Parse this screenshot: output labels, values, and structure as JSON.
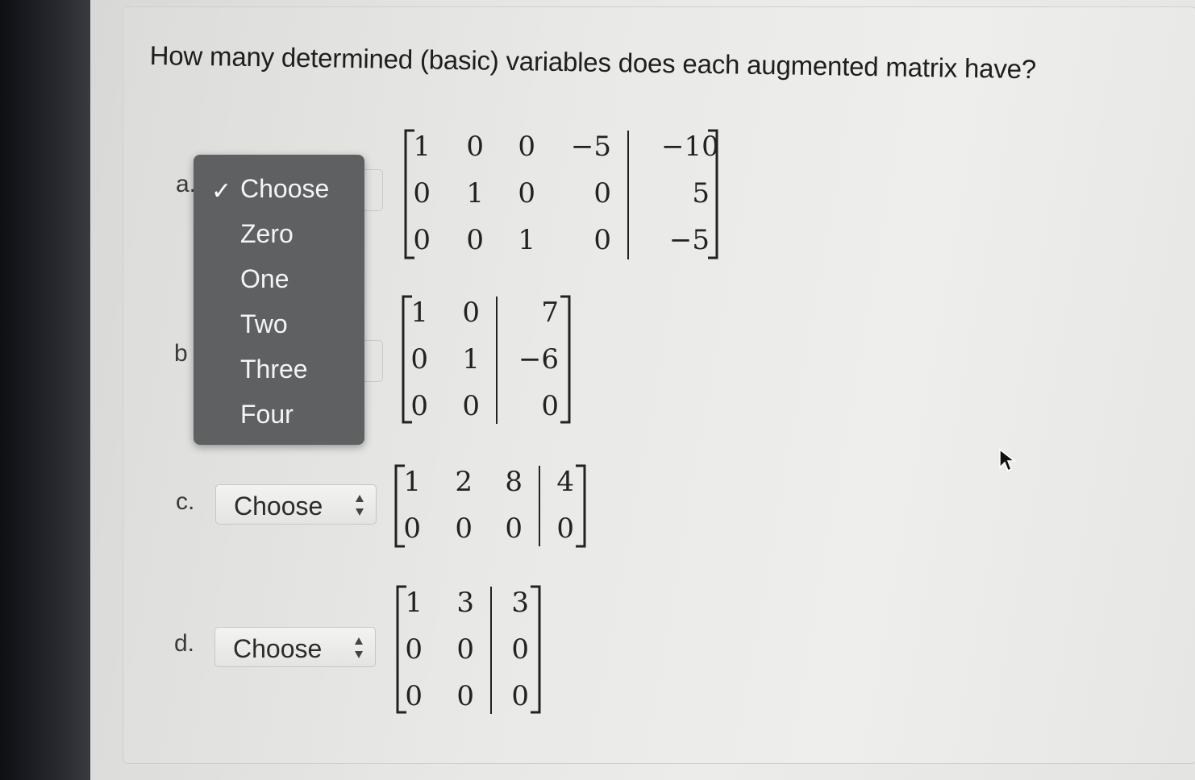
{
  "question": "How many determined (basic) variables does each augmented matrix have?",
  "items": [
    {
      "label": "a.",
      "select": "Choose"
    },
    {
      "label": "b",
      "select": "Choose"
    },
    {
      "label": "c.",
      "select": "Choose"
    },
    {
      "label": "d.",
      "select": "Choose"
    }
  ],
  "dropdown": {
    "selected": "Choose",
    "checkmark": "✓",
    "options": [
      "Choose",
      "Zero",
      "One",
      "Two",
      "Three",
      "Four"
    ]
  },
  "matrices": {
    "a": {
      "coef": [
        [
          "1",
          "0",
          "0",
          "−5"
        ],
        [
          "0",
          "1",
          "0",
          "0"
        ],
        [
          "0",
          "0",
          "1",
          "0"
        ]
      ],
      "rhs": [
        "−10",
        "5",
        "−5"
      ]
    },
    "b": {
      "coef": [
        [
          "1",
          "0"
        ],
        [
          "0",
          "1"
        ],
        [
          "0",
          "0"
        ]
      ],
      "rhs": [
        "7",
        "−6",
        "0"
      ]
    },
    "c": {
      "coef": [
        [
          "1",
          "2",
          "8"
        ],
        [
          "0",
          "0",
          "0"
        ]
      ],
      "rhs": [
        "4",
        "0"
      ]
    },
    "d": {
      "coef": [
        [
          "1",
          "3"
        ],
        [
          "0",
          "0"
        ],
        [
          "0",
          "0"
        ]
      ],
      "rhs": [
        "3",
        "0",
        "0"
      ]
    }
  },
  "colors": {
    "dropdown_bg": "#5f6062",
    "dropdown_text": "#f4f4f4",
    "page_bg": "#e9e9e7"
  }
}
